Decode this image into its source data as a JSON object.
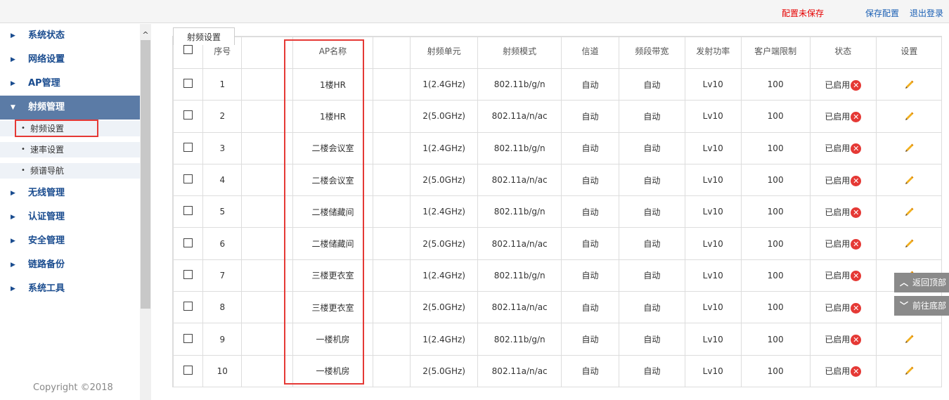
{
  "topbar": {
    "unsaved": "配置未保存",
    "save": "保存配置",
    "logout": "退出登录"
  },
  "sidebar": {
    "items": [
      {
        "label": "系统状态"
      },
      {
        "label": "网络设置"
      },
      {
        "label": "AP管理"
      },
      {
        "label": "射频管理"
      },
      {
        "label": "无线管理"
      },
      {
        "label": "认证管理"
      },
      {
        "label": "安全管理"
      },
      {
        "label": "链路备份"
      },
      {
        "label": "系统工具"
      }
    ],
    "sub": [
      {
        "label": "射频设置"
      },
      {
        "label": "速率设置"
      },
      {
        "label": "频谱导航"
      }
    ],
    "copyright": "Copyright ©2018"
  },
  "tab": {
    "label": "射频设置"
  },
  "table": {
    "headers": [
      "序号",
      "AP名称",
      "射频单元",
      "射频模式",
      "信道",
      "频段带宽",
      "发射功率",
      "客户端限制",
      "状态",
      "设置"
    ],
    "rows": [
      {
        "no": "1",
        "ap": "1楼HR",
        "unit": "1(2.4GHz)",
        "mode": "802.11b/g/n",
        "ch": "自动",
        "bw": "自动",
        "pw": "Lv10",
        "lim": "100",
        "st": "已启用"
      },
      {
        "no": "2",
        "ap": "1楼HR",
        "unit": "2(5.0GHz)",
        "mode": "802.11a/n/ac",
        "ch": "自动",
        "bw": "自动",
        "pw": "Lv10",
        "lim": "100",
        "st": "已启用"
      },
      {
        "no": "3",
        "ap": "二楼会议室",
        "unit": "1(2.4GHz)",
        "mode": "802.11b/g/n",
        "ch": "自动",
        "bw": "自动",
        "pw": "Lv10",
        "lim": "100",
        "st": "已启用"
      },
      {
        "no": "4",
        "ap": "二楼会议室",
        "unit": "2(5.0GHz)",
        "mode": "802.11a/n/ac",
        "ch": "自动",
        "bw": "自动",
        "pw": "Lv10",
        "lim": "100",
        "st": "已启用"
      },
      {
        "no": "5",
        "ap": "二楼储藏间",
        "unit": "1(2.4GHz)",
        "mode": "802.11b/g/n",
        "ch": "自动",
        "bw": "自动",
        "pw": "Lv10",
        "lim": "100",
        "st": "已启用"
      },
      {
        "no": "6",
        "ap": "二楼储藏间",
        "unit": "2(5.0GHz)",
        "mode": "802.11a/n/ac",
        "ch": "自动",
        "bw": "自动",
        "pw": "Lv10",
        "lim": "100",
        "st": "已启用"
      },
      {
        "no": "7",
        "ap": "三楼更衣室",
        "unit": "1(2.4GHz)",
        "mode": "802.11b/g/n",
        "ch": "自动",
        "bw": "自动",
        "pw": "Lv10",
        "lim": "100",
        "st": "已启用"
      },
      {
        "no": "8",
        "ap": "三楼更衣室",
        "unit": "2(5.0GHz)",
        "mode": "802.11a/n/ac",
        "ch": "自动",
        "bw": "自动",
        "pw": "Lv10",
        "lim": "100",
        "st": "已启用"
      },
      {
        "no": "9",
        "ap": "一楼机房",
        "unit": "1(2.4GHz)",
        "mode": "802.11b/g/n",
        "ch": "自动",
        "bw": "自动",
        "pw": "Lv10",
        "lim": "100",
        "st": "已启用"
      },
      {
        "no": "10",
        "ap": "一楼机房",
        "unit": "2(5.0GHz)",
        "mode": "802.11a/n/ac",
        "ch": "自动",
        "bw": "自动",
        "pw": "Lv10",
        "lim": "100",
        "st": "已启用"
      }
    ]
  },
  "float": {
    "top": "返回顶部",
    "bottom": "前往底部"
  },
  "colors": {
    "accent": "#5b7ba6",
    "highlight": "#e53935",
    "link": "#1a5fb4"
  }
}
